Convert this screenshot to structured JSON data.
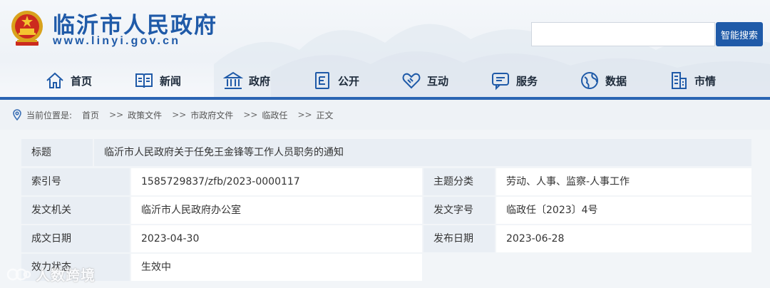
{
  "site": {
    "title": "临沂市人民政府",
    "url": "www.linyi.gov.cn",
    "emblem": "national-emblem-icon"
  },
  "search": {
    "value": "",
    "button_label": "智能搜索"
  },
  "nav": {
    "items": [
      {
        "label": "首页",
        "icon": "home-icon"
      },
      {
        "label": "新闻",
        "icon": "book-icon"
      },
      {
        "label": "政府",
        "icon": "government-building-icon"
      },
      {
        "label": "公开",
        "icon": "document-icon"
      },
      {
        "label": "互动",
        "icon": "handshake-icon"
      },
      {
        "label": "服务",
        "icon": "chat-service-icon"
      },
      {
        "label": "数据",
        "icon": "globe-data-icon"
      },
      {
        "label": "市情",
        "icon": "city-building-icon"
      }
    ]
  },
  "breadcrumb": {
    "label": "当前位置是:",
    "items": [
      "首页",
      "政策文件",
      "市政府文件",
      "临政任",
      "正文"
    ],
    "separator": ">>"
  },
  "meta": {
    "title_label": "标题",
    "title_value": "临沂市人民政府关于任免王金锋等工作人员职务的通知",
    "rows": [
      {
        "l1": "索引号",
        "v1": "1585729837/zfb/2023-0000117",
        "l2": "主题分类",
        "v2": "劳动、人事、监察-人事工作"
      },
      {
        "l1": "发文机关",
        "v1": "临沂市人民政府办公室",
        "l2": "发文字号",
        "v2": "临政任〔2023〕4号"
      },
      {
        "l1": "成文日期",
        "v1": "2023-04-30",
        "l2": "发布日期",
        "v2": "2023-06-28"
      },
      {
        "l1": "效力状态",
        "v1": "生效中"
      }
    ]
  },
  "watermark": {
    "text": "人数跨境"
  },
  "colors": {
    "brand_blue": "#1f5aa8",
    "label_bg": "#e9eef4",
    "page_bg": "#f2f5f8"
  }
}
